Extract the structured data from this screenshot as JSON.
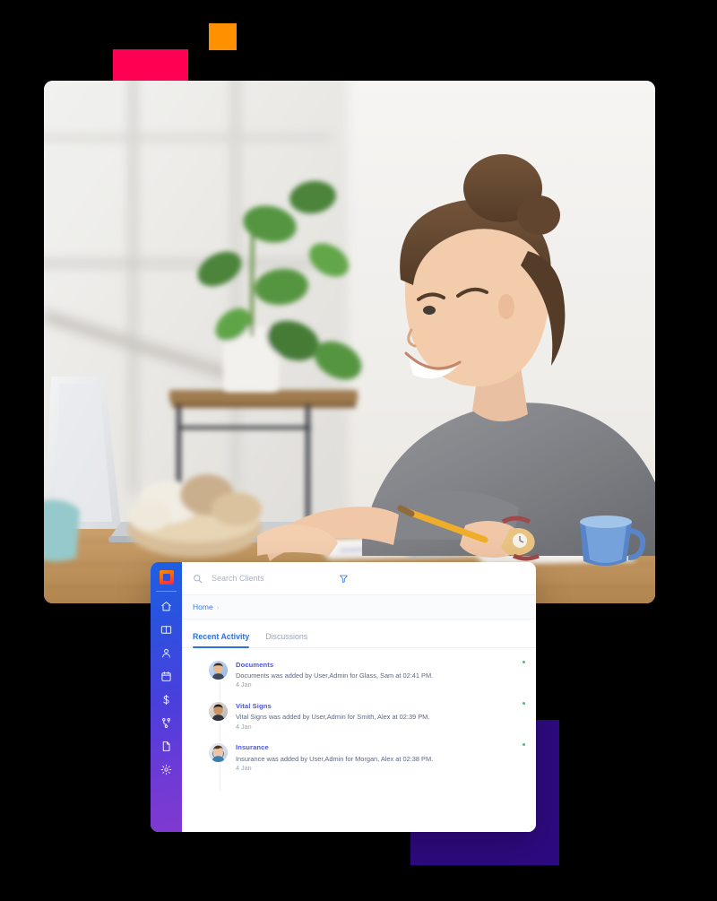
{
  "decor": {
    "orange_square": {
      "color": "#FF9000",
      "name": "orange-square"
    },
    "pink_rect": {
      "color": "#FF0052",
      "name": "pink-rectangle"
    },
    "purple_rect": {
      "color": "#2E0A80",
      "name": "purple-rectangle"
    }
  },
  "photo": {
    "alt": "Smiling woman working at a laptop at a wooden desk with a plant, bowl of bread and blue mug"
  },
  "app": {
    "sidebar": {
      "logo_name": "app-logo",
      "items": [
        {
          "icon": "home-icon",
          "label": "Home"
        },
        {
          "icon": "book-icon",
          "label": "Library"
        },
        {
          "icon": "user-icon",
          "label": "Clients"
        },
        {
          "icon": "calendar-icon",
          "label": "Calendar"
        },
        {
          "icon": "dollar-icon",
          "label": "Billing"
        },
        {
          "icon": "workflow-icon",
          "label": "Workflows"
        },
        {
          "icon": "document-icon",
          "label": "Documents"
        },
        {
          "icon": "gear-icon",
          "label": "Settings"
        }
      ]
    },
    "search": {
      "placeholder": "Search Clients",
      "value": "",
      "icon": "search-icon",
      "filter_icon": "filter-icon"
    },
    "breadcrumb": {
      "items": [
        "Home"
      ],
      "separator": "›"
    },
    "tabs": [
      {
        "label": "Recent Activity",
        "active": true
      },
      {
        "label": "Discussions",
        "active": false
      }
    ],
    "activity": [
      {
        "title": "Documents",
        "description": "Documents was added by User,Admin for Glass, Sam at 02:41 PM.",
        "date": "4 Jan",
        "status": "online",
        "avatar": "male-avatar-1"
      },
      {
        "title": "Vital Signs",
        "description": "Vital Signs was added by User,Admin for Smith, Alex at 02:39 PM.",
        "date": "4 Jan",
        "status": "online",
        "avatar": "male-avatar-2"
      },
      {
        "title": "Insurance",
        "description": "Insurance was added by User,Admin for Morgan, Alex at 02:38 PM.",
        "date": "4 Jan",
        "status": "online",
        "avatar": "female-avatar-1"
      }
    ],
    "colors": {
      "accent": "#2f6fe0",
      "title_link": "#4a55e0",
      "status_online": "#2ed06a",
      "sidebar_from": "#1f5fe0",
      "sidebar_to": "#8039cf"
    }
  }
}
